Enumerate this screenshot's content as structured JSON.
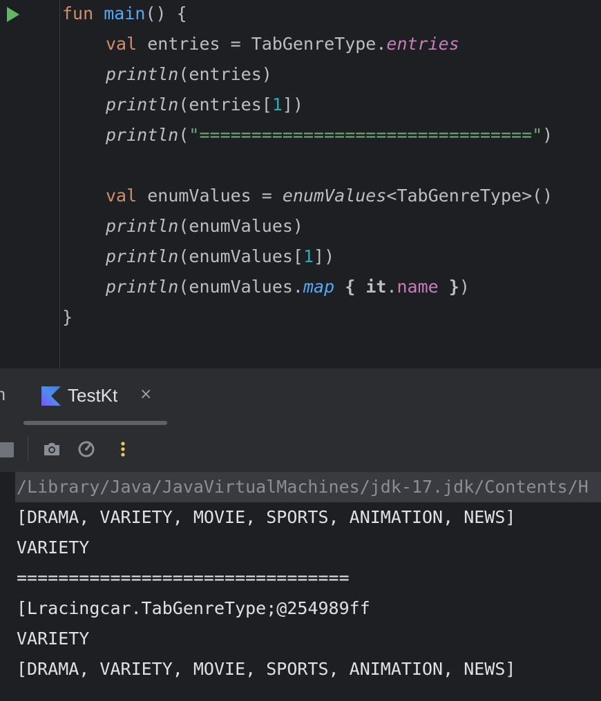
{
  "editor": {
    "code": {
      "fun_kw": "fun",
      "main_name": "main",
      "main_tail": "() {",
      "val_kw": "val",
      "entries_decl_name": "entries = TabGenreType.",
      "entries_prop": "entries",
      "println": "println",
      "entries_arg": "(entries)",
      "entries_idx_open": "(entries[",
      "idx_one": "1",
      "idx_close": "])",
      "sep_open": "(",
      "sep_string": "\"================================\"",
      "sep_close": ")",
      "ev_decl_name": "enumValues = ",
      "ev_fn": "enumValues",
      "ev_generic": "<TabGenreType>()",
      "ev_arg": "(enumValues)",
      "ev_idx_open": "(enumValues[",
      "ev_map_open": "(enumValues.",
      "map_fn": "map",
      "brace_open": "{",
      "it_kw": "it",
      "dot": ".",
      "name_prop": "name",
      "brace_close": "}",
      "paren_close": ")",
      "closing_brace": "}"
    }
  },
  "tool_window": {
    "clipped_tab_label": "n",
    "tab": {
      "label": "TestKt",
      "close_glyph": "×"
    },
    "more_glyph": "⋮"
  },
  "console": {
    "lines": [
      "/Library/Java/JavaVirtualMachines/jdk-17.jdk/Contents/H",
      "[DRAMA, VARIETY, MOVIE, SPORTS, ANIMATION, NEWS]",
      "VARIETY",
      "================================",
      "[Lracingcar.TabGenreType;@254989ff",
      "VARIETY",
      "[DRAMA, VARIETY, MOVIE, SPORTS, ANIMATION, NEWS]"
    ]
  },
  "icons": {
    "run": "run-gutter-icon",
    "kotlin": "kotlin-file-icon",
    "stop": "stop-icon",
    "camera": "camera-icon",
    "profiler": "profiler-icon",
    "more": "more-vertical-icon"
  },
  "colors": {
    "keyword": "#cf8e6d",
    "function": "#56a8f5",
    "property": "#c77dbb",
    "number": "#2aacb8",
    "string": "#6aab73",
    "text": "#bcbec4",
    "background": "#1e1f22",
    "panel": "#2b2d30",
    "run_green": "#5fb865",
    "more_yellow": "#f2c55c"
  }
}
